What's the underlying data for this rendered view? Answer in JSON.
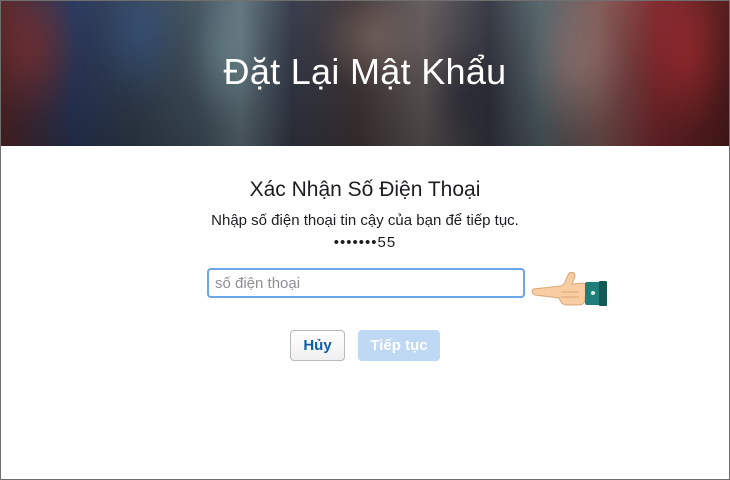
{
  "header": {
    "title": "Đặt Lại Mật Khẩu"
  },
  "verify": {
    "title": "Xác Nhận Số Điện Thoại",
    "instruction": "Nhập số điện thoại tin cậy của bạn để tiếp tục.",
    "masked_number": "•••••••55"
  },
  "phone_input": {
    "placeholder": "số điện thoại",
    "value": ""
  },
  "buttons": {
    "cancel_label": "Hủy",
    "continue_label": "Tiếp tục"
  },
  "annotation": {
    "icon": "pointing-hand-icon"
  },
  "colors": {
    "input_focus_border": "#6aa6e8",
    "cancel_text": "#0e5fa8",
    "continue_disabled_bg": "#bfd8f3"
  }
}
